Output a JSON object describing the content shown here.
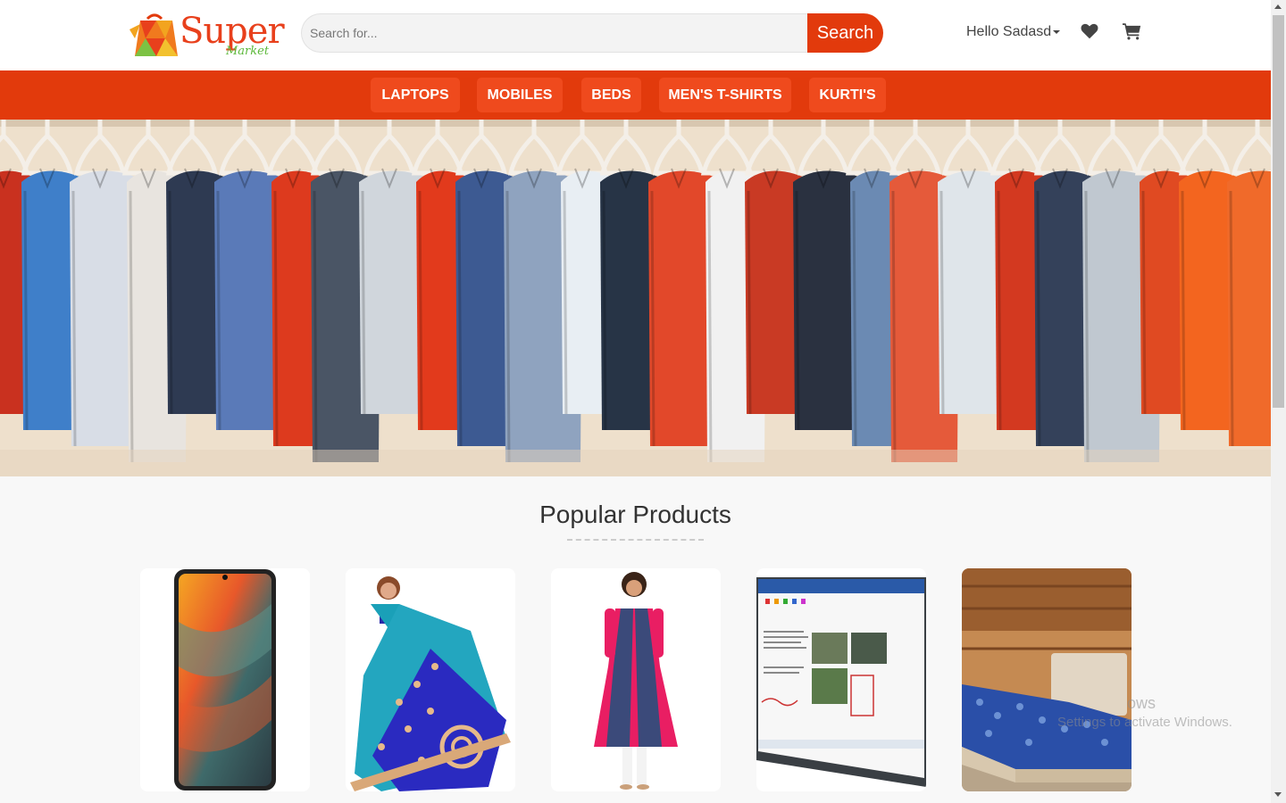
{
  "brand": {
    "name": "Super",
    "tagline": "Market",
    "color": "#e8401c",
    "tagline_color": "#5cb83a"
  },
  "search": {
    "placeholder": "Search for...",
    "value": "",
    "button_label": "Search"
  },
  "user": {
    "greeting": "Hello Sadasd"
  },
  "header_icons": [
    "heart-icon",
    "shopping-cart-icon"
  ],
  "categories": [
    {
      "label": "LAPTOPS"
    },
    {
      "label": "MOBILES"
    },
    {
      "label": "BEDS"
    },
    {
      "label": "MEN'S T-SHIRTS"
    },
    {
      "label": "KURTI'S"
    }
  ],
  "banner": {
    "subject": "rack-of-shirts"
  },
  "popular": {
    "title": "Popular Products",
    "products": [
      {
        "image": "smartphone"
      },
      {
        "image": "saree"
      },
      {
        "image": "kurti"
      },
      {
        "image": "laptop"
      },
      {
        "image": "bed"
      }
    ]
  },
  "watermark": {
    "line1": "ows",
    "line2": "Settings to activate Windows."
  },
  "colors": {
    "accent": "#e23a0c",
    "nav_button": "#ef4a1d",
    "page_background": "#f8f8f8"
  }
}
